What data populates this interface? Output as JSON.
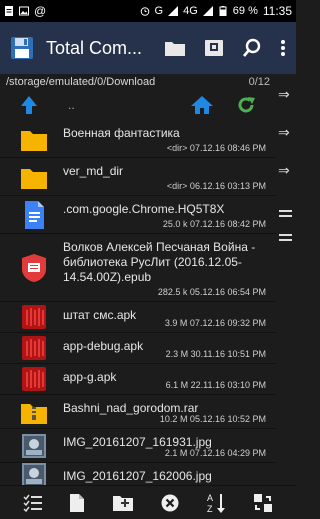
{
  "status_bar": {
    "battery": "69 %",
    "time": "11:35",
    "network": "4G",
    "signal_letter": "G"
  },
  "app_bar": {
    "title": "Total Com..."
  },
  "path_bar": {
    "path": "/storage/emulated/0/Download",
    "count": "0/12"
  },
  "tool_row": {
    "parent": ".."
  },
  "files": [
    {
      "name": "Военная фантастика",
      "meta": "<dir>  07.12.16  08:46 PM",
      "icon": "folder-icon",
      "color": "#f6b400"
    },
    {
      "name": "ver_md_dir",
      "meta": "<dir>  06.12.16  03:13 PM",
      "icon": "folder-icon",
      "color": "#f6b400"
    },
    {
      "name": ".com.google.Chrome.HQ5T8X",
      "meta": "25.0 k  07.12.16  08:42 PM",
      "icon": "document-icon",
      "color": "#3b82f6"
    },
    {
      "name": "Волков Алексей Песчаная Война - библиотека РусЛит (2016.12.05-14.54.00Z).epub",
      "meta": "282.5 k  05.12.16  06:54 PM",
      "icon": "epub-icon",
      "color": "#e23b3b"
    },
    {
      "name": "штат смс.apk",
      "meta": "3.9 M  07.12.16  09:32 PM",
      "icon": "apk-icon",
      "color": "#b01414"
    },
    {
      "name": "app-debug.apk",
      "meta": "2.3 M  30.11.16  10:51 PM",
      "icon": "apk-icon",
      "color": "#b01414"
    },
    {
      "name": "app-g.apk",
      "meta": "6.1 M  22.11.16  03:10 PM",
      "icon": "apk-icon",
      "color": "#b01414"
    },
    {
      "name": "Bashni_nad_gorodom.rar",
      "meta": "10.2 M  05.12.16  10:52 PM",
      "icon": "archive-icon",
      "color": "#f6b400"
    },
    {
      "name": "IMG_20161207_161931.jpg",
      "meta": "2.1 M  07.12.16  04:29 PM",
      "icon": "image-icon",
      "color": "#7a8fa6"
    },
    {
      "name": "IMG_20161207_162006.jpg",
      "meta": "",
      "icon": "image-icon",
      "color": "#7a8fa6"
    }
  ],
  "colors": {
    "accent_blue": "#1e88e5",
    "refresh_green": "#4caf50",
    "appbar": "#26324b"
  }
}
